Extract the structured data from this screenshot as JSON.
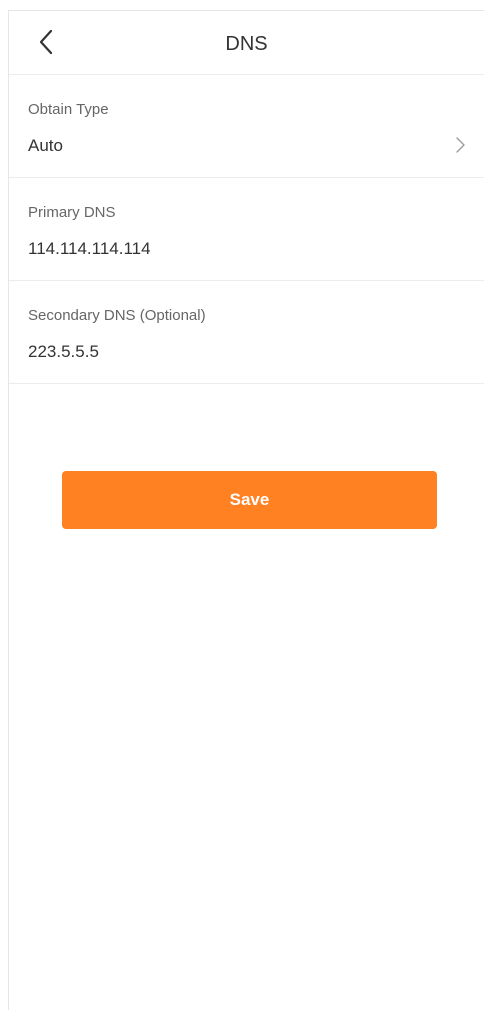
{
  "header": {
    "title": "DNS",
    "back_icon": "chevron-left-icon"
  },
  "fields": {
    "obtain_type": {
      "label": "Obtain Type",
      "value": "Auto",
      "icon": "chevron-right-icon"
    },
    "primary_dns": {
      "label": "Primary DNS",
      "value": "114.114.114.114"
    },
    "secondary_dns": {
      "label": "Secondary DNS (Optional)",
      "value": "223.5.5.5"
    }
  },
  "actions": {
    "save_label": "Save"
  },
  "colors": {
    "accent": "#ff8122",
    "divider": "#ececec",
    "label": "#666666",
    "text": "#333333"
  }
}
